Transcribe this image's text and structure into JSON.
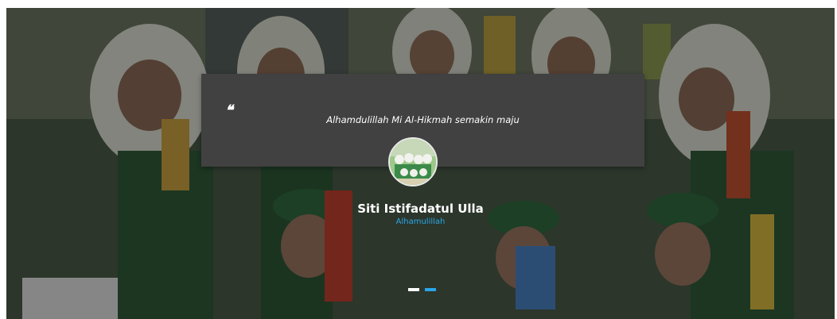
{
  "testimonial": {
    "quote_icon": "❝",
    "quote": "Alhamdulillah Mi Al-Hikmah semakin maju",
    "name": "Siti Istifadatul Ulla",
    "role": "Alhamulillah"
  },
  "colors": {
    "card": "#414141",
    "role_text": "#2aa6e8",
    "dot_inactive": "#ffffff",
    "dot_active": "#2aa6e8"
  },
  "carousel": {
    "active_index": 1,
    "dots": [
      "slide-1",
      "slide-2"
    ]
  }
}
